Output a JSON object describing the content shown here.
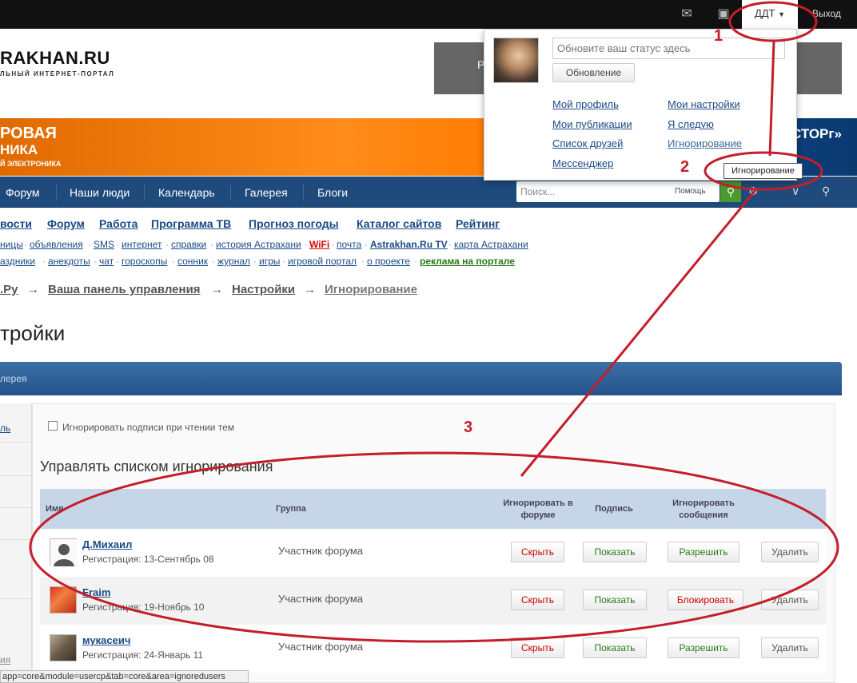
{
  "topbar": {
    "icons": [
      "mail-icon",
      "contact-card-icon"
    ],
    "user_label": "ДДТ",
    "exit_label": "Выход"
  },
  "logo": {
    "text": "RAKHAN.RU",
    "subtitle": "ЛЬНЫЙ ИНТЕРНЕТ-ПОРТАЛ"
  },
  "banner": {
    "grey_text": "Р",
    "orange_line1": "РОВАЯ",
    "orange_line2": "НИКА",
    "orange_line3": "Й ЭЛЕКТРОНИКА",
    "orange_right": "СТОРг»"
  },
  "nav": {
    "items": [
      "Форум",
      "Наши люди",
      "Календарь",
      "Галерея",
      "Блоги"
    ],
    "search_placeholder": "Поиск...",
    "search_scope": "Помощь"
  },
  "main_links": [
    "вости",
    "Форум",
    "Работа",
    "Программа ТВ",
    "Прогноз погоды",
    "Каталог сайтов",
    "Рейтинг"
  ],
  "sub_links_row1": [
    "ницы",
    "объявления",
    "SMS",
    "интернет",
    "справки",
    "история Астрахани",
    "WiFi",
    "почта",
    "Astrakhan.Ru TV",
    "карта Астрахани"
  ],
  "sub_links_row2": [
    "аздники",
    "анекдоты",
    "чат",
    "гороскопы",
    "сонник",
    "журнал",
    "игры",
    "игровой портал",
    "о проекте",
    "реклама на портале"
  ],
  "breadcrumb": {
    "items": [
      ".Ру",
      "Ваша панель управления",
      "Настройки",
      "Игнорирование"
    ],
    "separator": "→"
  },
  "page_title": "тройки",
  "panel_header": "лерея",
  "left_col": {
    "link_top": "ль",
    "link_bottom": "ия"
  },
  "ignore_signatures_label": "Игнорировать подписи при чтении тем",
  "manage_title": "Управлять списком игнорирования",
  "table": {
    "headers": {
      "name": "Имя",
      "group": "Группа",
      "ignore_forum": "Игнорировать в форуме",
      "signature": "Подпись",
      "ignore_messages": "Игнорировать сообщения"
    },
    "rows": [
      {
        "name": "Д.Михаил",
        "reg": "Регистрация: 13-Сентябрь 08",
        "group": "Участник форума",
        "btn_forum": "Скрыть",
        "btn_sig": "Показать",
        "btn_msg": "Разрешить",
        "btn_delete": "Удалить"
      },
      {
        "name": "Fraim",
        "reg": "Регистрация: 19-Ноябрь 10",
        "group": "Участник форума",
        "btn_forum": "Скрыть",
        "btn_sig": "Показать",
        "btn_msg": "Блокировать",
        "btn_delete": "Удалить"
      },
      {
        "name": "мукасеич",
        "reg": "Регистрация: 24-Январь 11",
        "group": "Участник форума",
        "btn_forum": "Скрыть",
        "btn_sig": "Показать",
        "btn_msg": "Разрешить",
        "btn_delete": "Удалить"
      }
    ]
  },
  "dropdown": {
    "status_placeholder": "Обновите ваш статус здесь",
    "update_button": "Обновление",
    "links_left": [
      "Мой профиль",
      "Мои публикации",
      "Список друзей",
      "Мессенджер"
    ],
    "links_right": [
      "Мои настройки",
      "Я следую",
      "Игнорирование"
    ],
    "tooltip": "Игнорирование"
  },
  "annotations": [
    "1",
    "2",
    "3"
  ],
  "status_bar": "app=core&module=usercp&tab=core&area=ignoredusers",
  "colors": {
    "annotation": "#c41e2a",
    "nav": "#1e4a7c",
    "link": "#1a4a86"
  }
}
